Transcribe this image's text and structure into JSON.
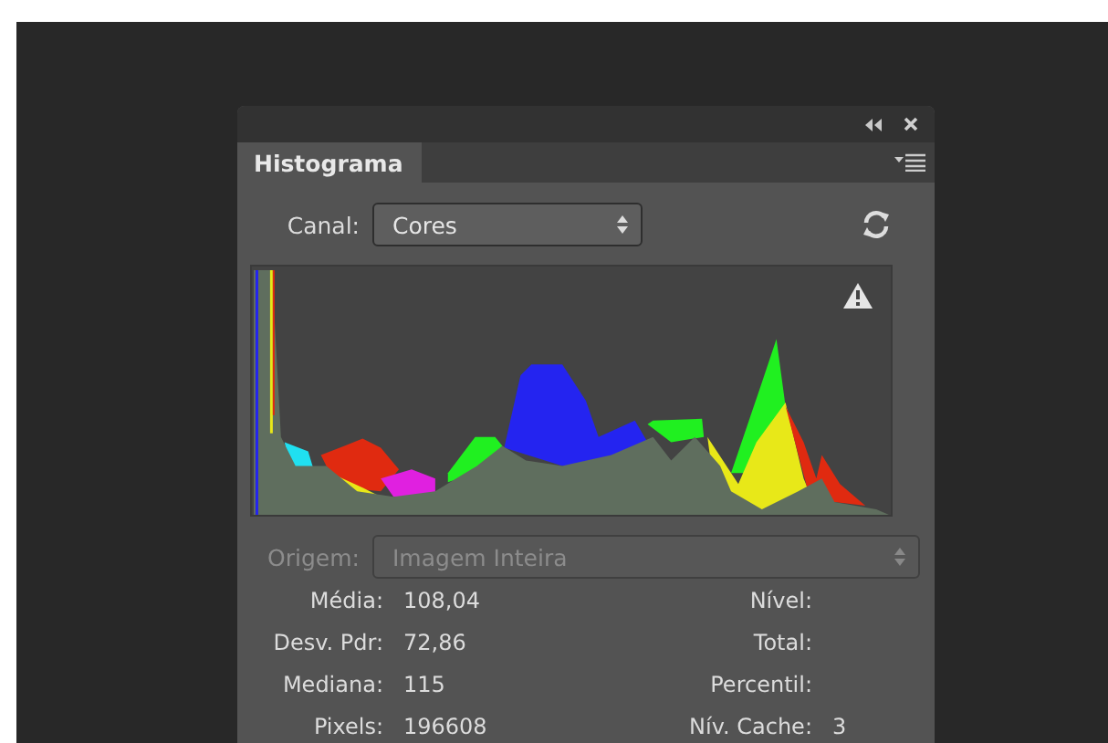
{
  "panel": {
    "tab": {
      "label": "Histograma",
      "selected": true
    },
    "channel": {
      "label": "Canal:",
      "value": "Cores"
    },
    "source": {
      "label": "Origem:",
      "value": "Imagem Inteira",
      "disabled": true
    },
    "stats_left": [
      {
        "label": "Média:",
        "value": "108,04"
      },
      {
        "label": "Desv. Pdr:",
        "value": "72,86"
      },
      {
        "label": "Mediana:",
        "value": "115"
      },
      {
        "label": "Pixels:",
        "value": "196608"
      }
    ],
    "stats_right": [
      {
        "label": "Nível:"
      },
      {
        "label": "Total:"
      },
      {
        "label": "Percentil:"
      },
      {
        "label": "Nív. Cache:",
        "value": "3"
      }
    ]
  }
}
